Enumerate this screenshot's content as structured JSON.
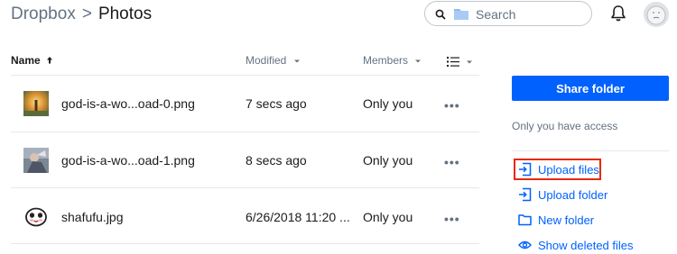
{
  "breadcrumb": {
    "root": "Dropbox",
    "separator": ">",
    "current": "Photos"
  },
  "search": {
    "placeholder": "Search"
  },
  "table": {
    "headers": {
      "name": "Name",
      "modified": "Modified",
      "members": "Members"
    },
    "rows": [
      {
        "name": "god-is-a-wo...oad-0.png",
        "modified": "7 secs ago",
        "members": "Only you",
        "more": "•••"
      },
      {
        "name": "god-is-a-wo...oad-1.png",
        "modified": "8 secs ago",
        "members": "Only you",
        "more": "•••"
      },
      {
        "name": "shafufu.jpg",
        "modified": "6/26/2018 11:20 ...",
        "members": "Only you",
        "more": "•••"
      }
    ]
  },
  "sidebar": {
    "share_button": "Share folder",
    "access_text": "Only you have access",
    "actions": {
      "upload_files": "Upload files",
      "upload_folder": "Upload folder",
      "new_folder": "New folder",
      "show_deleted": "Show deleted files"
    }
  },
  "colors": {
    "accent": "#0061fe",
    "highlight": "#e8280c",
    "muted": "#637282"
  }
}
